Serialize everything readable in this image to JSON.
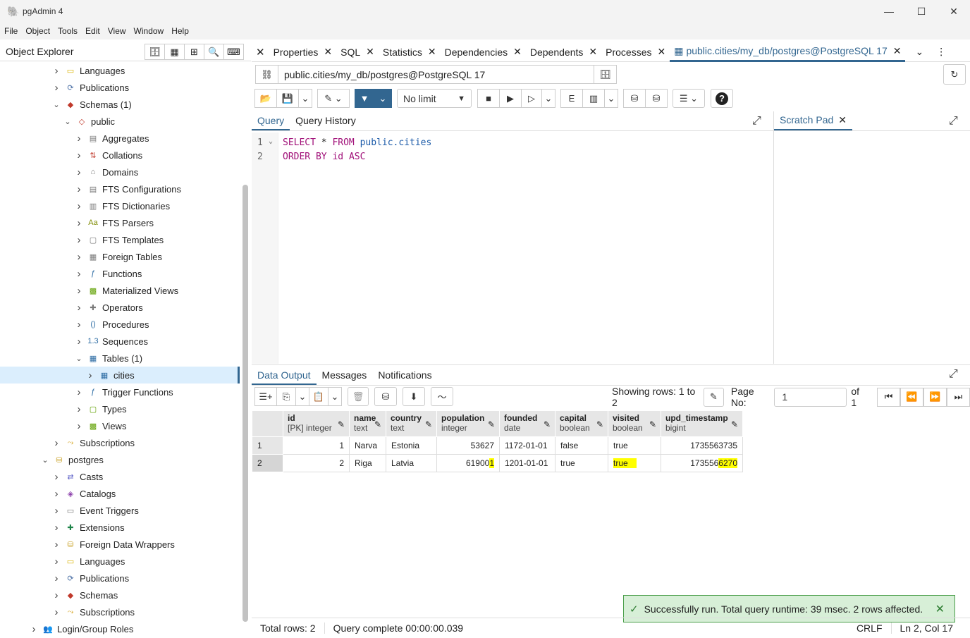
{
  "window": {
    "title": "pgAdmin 4"
  },
  "menu": [
    "File",
    "Object",
    "Tools",
    "Edit",
    "View",
    "Window",
    "Help"
  ],
  "object_explorer": {
    "title": "Object Explorer",
    "items": [
      {
        "label": "Languages",
        "depth": 2,
        "chev": ">",
        "icon": "languages-icon"
      },
      {
        "label": "Publications",
        "depth": 2,
        "chev": ">",
        "icon": "publications-icon"
      },
      {
        "label": "Schemas (1)",
        "depth": 2,
        "chev": "v",
        "icon": "schemas-icon"
      },
      {
        "label": "public",
        "depth": 3,
        "chev": "v",
        "icon": "schema-icon"
      },
      {
        "label": "Aggregates",
        "depth": 4,
        "chev": ">",
        "icon": "aggregates-icon"
      },
      {
        "label": "Collations",
        "depth": 4,
        "chev": ">",
        "icon": "collations-icon"
      },
      {
        "label": "Domains",
        "depth": 4,
        "chev": ">",
        "icon": "domains-icon"
      },
      {
        "label": "FTS Configurations",
        "depth": 4,
        "chev": ">",
        "icon": "fts-configurations-icon"
      },
      {
        "label": "FTS Dictionaries",
        "depth": 4,
        "chev": ">",
        "icon": "fts-dictionaries-icon"
      },
      {
        "label": "FTS Parsers",
        "depth": 4,
        "chev": ">",
        "icon": "fts-parsers-icon"
      },
      {
        "label": "FTS Templates",
        "depth": 4,
        "chev": ">",
        "icon": "fts-templates-icon"
      },
      {
        "label": "Foreign Tables",
        "depth": 4,
        "chev": ">",
        "icon": "foreign-tables-icon"
      },
      {
        "label": "Functions",
        "depth": 4,
        "chev": ">",
        "icon": "functions-icon"
      },
      {
        "label": "Materialized Views",
        "depth": 4,
        "chev": ">",
        "icon": "materialized-views-icon"
      },
      {
        "label": "Operators",
        "depth": 4,
        "chev": ">",
        "icon": "operators-icon"
      },
      {
        "label": "Procedures",
        "depth": 4,
        "chev": ">",
        "icon": "procedures-icon"
      },
      {
        "label": "Sequences",
        "depth": 4,
        "chev": ">",
        "icon": "sequences-icon"
      },
      {
        "label": "Tables (1)",
        "depth": 4,
        "chev": "v",
        "icon": "tables-icon"
      },
      {
        "label": "cities",
        "depth": 5,
        "chev": ">",
        "icon": "table-icon",
        "selected": true
      },
      {
        "label": "Trigger Functions",
        "depth": 4,
        "chev": ">",
        "icon": "trigger-functions-icon"
      },
      {
        "label": "Types",
        "depth": 4,
        "chev": ">",
        "icon": "types-icon"
      },
      {
        "label": "Views",
        "depth": 4,
        "chev": ">",
        "icon": "views-icon"
      },
      {
        "label": "Subscriptions",
        "depth": 2,
        "chev": ">",
        "icon": "subscriptions-icon"
      },
      {
        "label": "postgres",
        "depth": 1,
        "chev": "v",
        "icon": "database-icon"
      },
      {
        "label": "Casts",
        "depth": 2,
        "chev": ">",
        "icon": "casts-icon"
      },
      {
        "label": "Catalogs",
        "depth": 2,
        "chev": ">",
        "icon": "catalogs-icon"
      },
      {
        "label": "Event Triggers",
        "depth": 2,
        "chev": ">",
        "icon": "event-triggers-icon"
      },
      {
        "label": "Extensions",
        "depth": 2,
        "chev": ">",
        "icon": "extensions-icon"
      },
      {
        "label": "Foreign Data Wrappers",
        "depth": 2,
        "chev": ">",
        "icon": "foreign-data-wrappers-icon"
      },
      {
        "label": "Languages",
        "depth": 2,
        "chev": ">",
        "icon": "languages-icon"
      },
      {
        "label": "Publications",
        "depth": 2,
        "chev": ">",
        "icon": "publications-icon"
      },
      {
        "label": "Schemas",
        "depth": 2,
        "chev": ">",
        "icon": "schemas-icon"
      },
      {
        "label": "Subscriptions",
        "depth": 2,
        "chev": ">",
        "icon": "subscriptions-icon"
      },
      {
        "label": "Login/Group Roles",
        "depth": 0,
        "chev": ">",
        "icon": "roles-icon"
      }
    ]
  },
  "tabs": [
    "Properties",
    "SQL",
    "Statistics",
    "Dependencies",
    "Dependents",
    "Processes",
    "public.cities/my_db/postgres@PostgreSQL 17"
  ],
  "connection": "public.cities/my_db/postgres@PostgreSQL 17",
  "limit": "No limit",
  "query_tabs": [
    "Query",
    "Query History"
  ],
  "scratch_pad": "Scratch Pad",
  "sql": {
    "line1": {
      "kw1": "SELECT",
      "rest1": " * ",
      "kw2": "FROM",
      "ident": " public.cities"
    },
    "line2": {
      "kw1": "ORDER BY",
      "ident": " id ",
      "kw2": "ASC"
    }
  },
  "output_tabs": [
    "Data Output",
    "Messages",
    "Notifications"
  ],
  "pagination": {
    "showing": "Showing rows: 1 to 2",
    "page_label": "Page No:",
    "page": "1",
    "of": "of 1"
  },
  "grid": {
    "columns": [
      {
        "name": "id",
        "type": "[PK] integer"
      },
      {
        "name": "name",
        "type": "text"
      },
      {
        "name": "country",
        "type": "text"
      },
      {
        "name": "population",
        "type": "integer"
      },
      {
        "name": "founded",
        "type": "date"
      },
      {
        "name": "capital",
        "type": "boolean"
      },
      {
        "name": "visited",
        "type": "boolean"
      },
      {
        "name": "upd_timestamp",
        "type": "bigint"
      }
    ],
    "rows": [
      {
        "rn": "1",
        "id": "1",
        "name": "Narva",
        "country": "Estonia",
        "population_a": "53627",
        "population_b": "",
        "founded": "1172-01-01",
        "capital": "false",
        "visited": "true",
        "ts_a": "1735563735",
        "ts_b": ""
      },
      {
        "rn": "2",
        "id": "2",
        "name": "Riga",
        "country": "Latvia",
        "population_a": "61900",
        "population_b": "1",
        "founded": "1201-01-01",
        "capital": "true",
        "visited": "true",
        "ts_a": "173556",
        "ts_b": "6270"
      }
    ]
  },
  "toast": "Successfully run. Total query runtime: 39 msec. 2 rows affected.",
  "status": {
    "total": "Total rows: 2",
    "complete": "Query complete 00:00:00.039",
    "eol": "CRLF",
    "pos": "Ln 2, Col 17"
  },
  "colors": {
    "accent": "#326690",
    "highlight": "#ffff00",
    "success": "#d7efd7"
  }
}
